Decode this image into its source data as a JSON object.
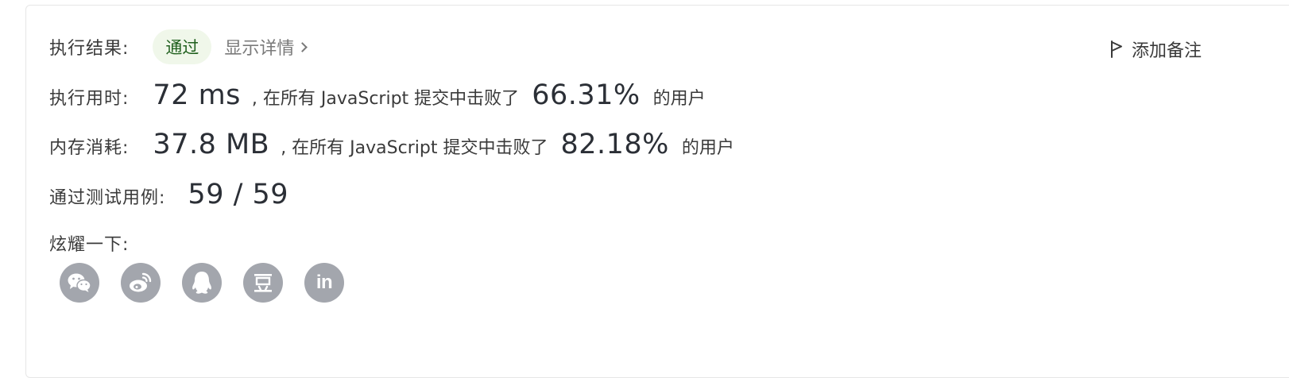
{
  "result": {
    "label": "执行结果:",
    "status": "通过",
    "details_link": "显示详情"
  },
  "add_note": "添加备注",
  "runtime": {
    "label": "执行用时:",
    "value": "72 ms",
    "middle_text": ", 在所有 JavaScript 提交中击败了",
    "percent": "66.31%",
    "suffix": "的用户"
  },
  "memory": {
    "label": "内存消耗:",
    "value": "37.8 MB",
    "middle_text": ", 在所有 JavaScript 提交中击败了",
    "percent": "82.18%",
    "suffix": "的用户"
  },
  "testcases": {
    "label": "通过测试用例:",
    "value": "59 / 59"
  },
  "share": {
    "label": "炫耀一下:",
    "icons": [
      "wechat-icon",
      "weibo-icon",
      "qq-icon",
      "douban-icon",
      "linkedin-icon"
    ],
    "douban_glyph": "豆",
    "linkedin_glyph": "in"
  },
  "colors": {
    "pass_badge_bg": "#f0f7ea",
    "pass_text": "#1f5f1d",
    "icon_circle": "#a3a6ad"
  }
}
